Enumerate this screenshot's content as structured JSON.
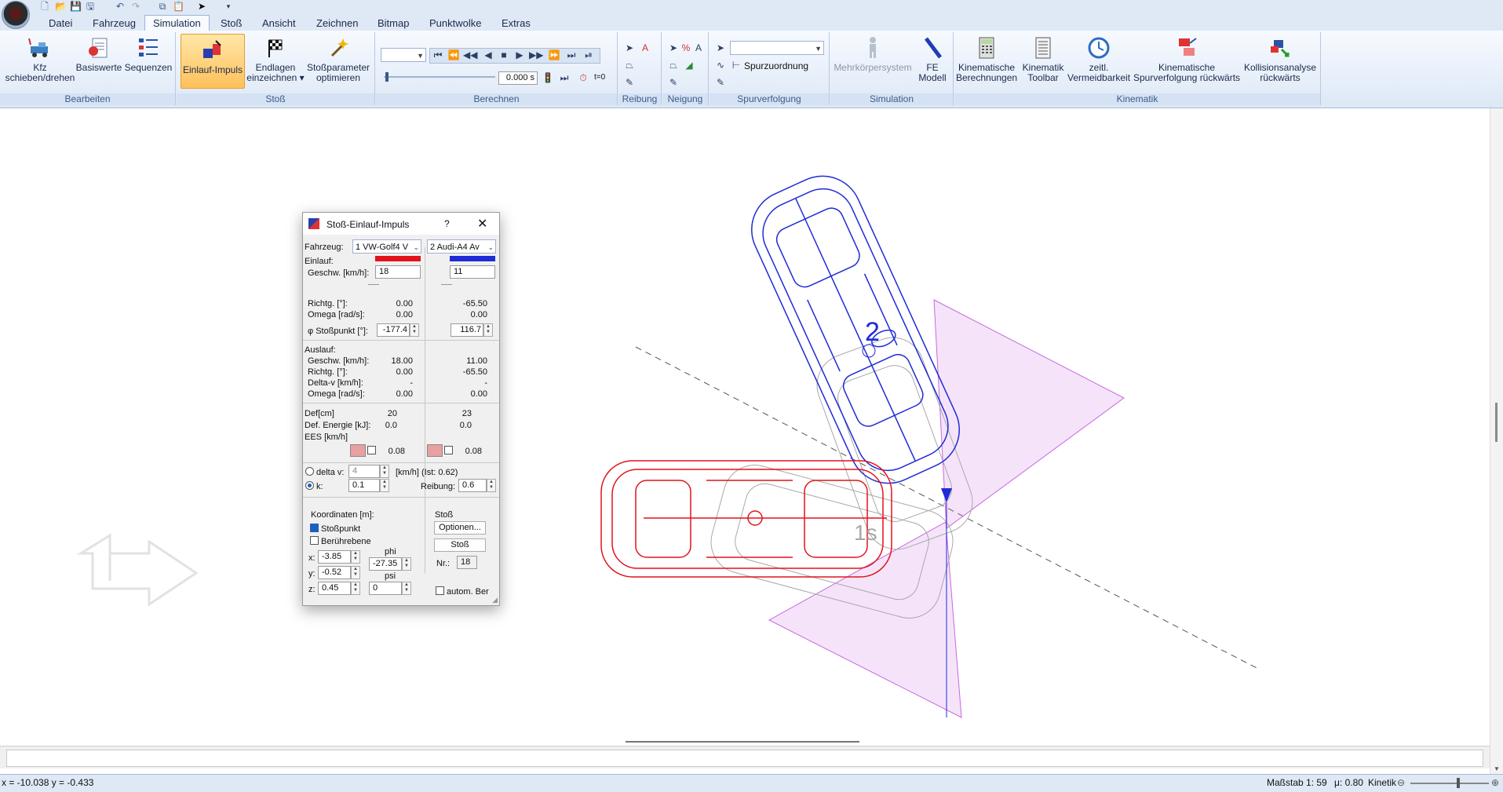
{
  "qat": {
    "icons": [
      "new-icon",
      "open-icon",
      "save-icon",
      "save-as-icon",
      "undo-icon",
      "redo-icon",
      "copy-icon",
      "paste-icon",
      "pointer-icon",
      "qat-dropdown-icon"
    ]
  },
  "tabs": [
    "Datei",
    "Fahrzeug",
    "Simulation",
    "Stoß",
    "Ansicht",
    "Zeichnen",
    "Bitmap",
    "Punktwolke",
    "Extras"
  ],
  "active_tab": "Simulation",
  "ribbon": {
    "groups": {
      "bearbeiten": "Bearbeiten",
      "stoss": "Stoß",
      "berechnen": "Berechnen",
      "reibung": "Reibung",
      "neigung": "Neigung",
      "spurverfolgung": "Spurverfolgung",
      "simulation": "Simulation",
      "kinematik": "Kinematik"
    },
    "buttons": {
      "kfz_1": "Kfz",
      "kfz_2": "schieben/drehen",
      "basiswerte": "Basiswerte",
      "sequenzen": "Sequenzen",
      "einlauf": "Einlauf-Impuls",
      "endlagen_1": "Endlagen",
      "endlagen_2": "einzeichnen ▾",
      "stossparam_1": "Stoßparameter",
      "stossparam_2": "optimieren",
      "time_value": "0.000 s",
      "t0": "t=0",
      "spurzuordnung": "Spurzuordnung",
      "mehrkoerper": "Mehrkörpersystem",
      "fe_1": "FE",
      "fe_2": "Modell",
      "kin_ber_1": "Kinematische",
      "kin_ber_2": "Berechnungen",
      "kin_tb_1": "Kinematik",
      "kin_tb_2": "Toolbar",
      "zeitl_1": "zeitl.",
      "zeitl_2": "Vermeidbarkeit",
      "kin_spur_1": "Kinematische",
      "kin_spur_2": "Spurverfolgung rückwärts",
      "koll_1": "Kollisionsanalyse",
      "koll_2": "rückwärts"
    }
  },
  "dialog": {
    "title": "Stoß-Einlauf-Impuls",
    "help": "?",
    "fahrzeug_label": "Fahrzeug:",
    "vehicle1": "1 VW-Golf4 V",
    "vehicle2": "2 Audi-A4 Av",
    "einlauf_label": "Einlauf:",
    "geschw_label": "Geschw. [km/h]:",
    "geschw1": "18",
    "geschw2": "11",
    "richtg_label": "Richtg. [°]:",
    "richtg1": "0.00",
    "richtg2": "-65.50",
    "omega_label": "Omega [rad/s]:",
    "omega1": "0.00",
    "omega2": "0.00",
    "phi_label": "φ Stoßpunkt [°]:",
    "phi1": "-177.4",
    "phi2": "116.7",
    "auslauf_label": "Auslauf:",
    "a_geschw_label": "Geschw. [km/h]:",
    "a_geschw1": "18.00",
    "a_geschw2": "11.00",
    "a_richtg_label": "Richtg. [°]:",
    "a_richtg1": "0.00",
    "a_richtg2": "-65.50",
    "a_deltav_label": "Delta-v [km/h]:",
    "a_deltav1": "-",
    "a_deltav2": "-",
    "a_omega_label": "Omega [rad/s]:",
    "a_omega1": "0.00",
    "a_omega2": "0.00",
    "def_label": "Def[cm]",
    "def1": "20",
    "def2": "23",
    "energie_label": "Def. Energie [kJ]:",
    "energie1": "0.0",
    "energie2": "0.0",
    "ees_label": "EES [km/h]",
    "ees1": "0.08",
    "ees2": "0.08",
    "deltav_radio": "delta v:",
    "deltav_value": "4",
    "deltav_unit": "[km/h] (Ist: 0.62)",
    "k_radio": "k:",
    "k_value": "0.1",
    "reibung_label": "Reibung:",
    "reibung_value": "0.6",
    "koord_label": "Koordinaten [m]:",
    "stosspunkt": "Stoßpunkt",
    "beruehrebene": "Berührebene",
    "x_label": "x:",
    "x_value": "-3.85",
    "y_label": "y:",
    "y_value": "-0.52",
    "z_label": "z:",
    "z_value": "0.45",
    "phi_coord_label": "phi",
    "phi_coord_value": "-27.35",
    "psi_label": "psi",
    "psi_value": "0",
    "stoss_group": "Stoß",
    "optionen": "Optionen...",
    "stoss_btn": "Stoß",
    "nr_label": "Nr.:",
    "nr_value": "18",
    "autom": "autom. Ber",
    "colors": {
      "vehicle1": "#e3121b",
      "vehicle2": "#1f2bd6"
    }
  },
  "canvas": {
    "vehicle1_label": "1s",
    "vehicle2_label": "2",
    "colors": {
      "vehicle1": "#e3121b",
      "vehicle2": "#1f2bd6",
      "triangles": "#c868e0"
    }
  },
  "status": {
    "coords": "x = -10.038 y = -0.433",
    "scale": "Maßstab 1: 59",
    "mu": "μ: 0.80",
    "mode": "Kinetik"
  }
}
